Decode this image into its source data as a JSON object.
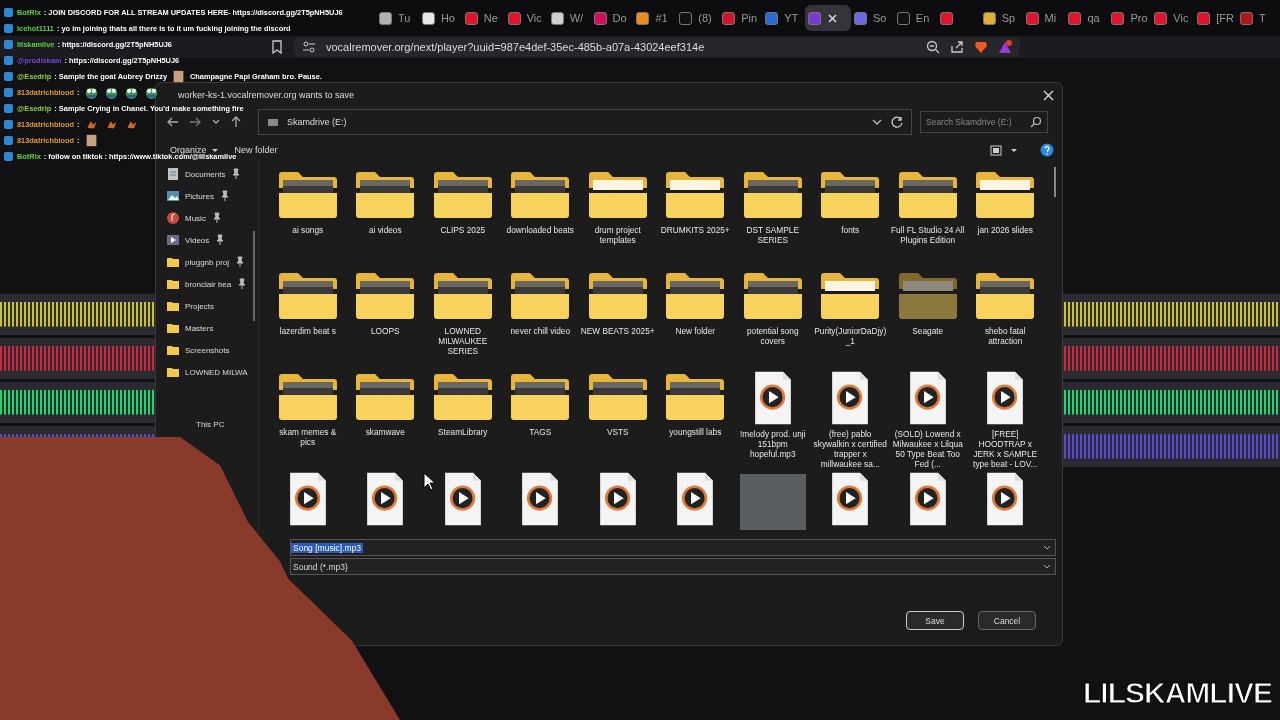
{
  "browser": {
    "tabs": [
      {
        "label": "Tu",
        "color": "#b0b0b0",
        "selected": false
      },
      {
        "label": "Ho",
        "color": "#e8e8e8",
        "selected": false
      },
      {
        "label": "Ne",
        "color": "#e0142a",
        "selected": false
      },
      {
        "label": "Vic",
        "color": "#e0142a",
        "selected": false
      },
      {
        "label": "W/",
        "color": "#cfcfcf",
        "selected": false
      },
      {
        "label": "Do",
        "color": "#d0105a",
        "selected": false
      },
      {
        "label": "#1",
        "color": "#f08a1c",
        "selected": false
      },
      {
        "label": "(8)",
        "color": "#111111",
        "selected": false
      },
      {
        "label": "Pin",
        "color": "#d0142a",
        "selected": false
      },
      {
        "label": "YT",
        "color": "#2a6ad8",
        "selected": false
      },
      {
        "color": "#7a3ad8",
        "selected": true
      },
      {
        "label": "So",
        "color": "#6a6ae8",
        "selected": false
      },
      {
        "label": "En",
        "color": "#111111",
        "selected": false
      },
      {
        "color": "#e0142a",
        "selected": false
      },
      {
        "label": "Sp",
        "color": "#e0b030",
        "selected": false
      },
      {
        "label": "Mi",
        "color": "#e0142a",
        "selected": false
      },
      {
        "label": "qa",
        "color": "#e0142a",
        "selected": false
      },
      {
        "label": "Pro",
        "color": "#e0142a",
        "selected": false
      },
      {
        "label": "Vic",
        "color": "#e0142a",
        "selected": false
      },
      {
        "label": "[FR",
        "color": "#e0142a",
        "selected": false
      },
      {
        "label": "T",
        "color": "#b01818",
        "selected": false
      }
    ],
    "url": "vocalremover.org/next/player?uuid=987e4def-35ec-485b-a07a-43024eef314e"
  },
  "chat": [
    {
      "user": "BotRix",
      "color": "#5ad43c",
      "text": ": JOIN DISCORD FOR ALL STREAM UPDATES HERE- https://discord.gg/2T5pNH5UJ6"
    },
    {
      "user": "icehot1111",
      "color": "#5ad43c",
      "text": ": yo im joining thats all there is to it um fucking joining the discord"
    },
    {
      "user": "lilskamlive",
      "color": "#5ad43c",
      "text": ": https://discord.gg/2T5pNH5UJ6"
    },
    {
      "user": "@prodiskam",
      "color": "#7a4ad8",
      "text": ": https://discord.gg/2T5pNH5UJ6"
    },
    {
      "user": "@Esedrip",
      "color": "#8fd43c",
      "text": ": Sample the goat Aubrey Drizzy",
      "emotes": [
        {
          "kind": "face"
        }
      ],
      "text_after": "Champagne Papi Graham bro. Pause."
    },
    {
      "user": "813datrichblood",
      "color": "#e09a2a",
      "text": ":",
      "emotes": [
        {
          "kind": "frog"
        },
        {
          "kind": "frog"
        },
        {
          "kind": "frog"
        },
        {
          "kind": "frog"
        }
      ]
    },
    {
      "user": "@Esedrip",
      "color": "#8fd43c",
      "text": ": Sample Crying in Chanel. You'd make something fire"
    },
    {
      "user": "813datrichblood",
      "color": "#e09a2a",
      "text": ":",
      "emotes": [
        {
          "kind": "bird"
        },
        {
          "kind": "bird"
        },
        {
          "kind": "bird"
        }
      ]
    },
    {
      "user": "813datrichblood",
      "color": "#e09a2a",
      "text": ":",
      "emotes": [
        {
          "kind": "face"
        }
      ]
    },
    {
      "user": "BotRix",
      "color": "#5ad43c",
      "text": ": follow on tiktok : https://www.tiktok.com/@lilskamlive"
    }
  ],
  "dialog": {
    "title": "worker-ks-1.vocalremover.org wants to save",
    "path": "Skamdrive (E:)",
    "search": {
      "placeholder": "Search Skamdrive (E:)"
    },
    "toolbar": [
      "Organize",
      "New folder"
    ],
    "sidebar": [
      {
        "label": "Documents",
        "kind": "documents",
        "pinned": true
      },
      {
        "label": "Pictures",
        "kind": "pictures",
        "pinned": true
      },
      {
        "label": "Music",
        "kind": "music",
        "pinned": true
      },
      {
        "label": "Videos",
        "kind": "videos",
        "pinned": true
      },
      {
        "label": "pluggnb proj",
        "kind": "folder",
        "pinned": true
      },
      {
        "label": "bronclair bea",
        "kind": "folder",
        "pinned": true
      },
      {
        "label": "Projects",
        "kind": "folder",
        "pinned": false
      },
      {
        "label": "Masters",
        "kind": "folder",
        "pinned": false
      },
      {
        "label": "Screenshots",
        "kind": "folder",
        "pinned": false
      },
      {
        "label": "LOWNED MILWA",
        "kind": "folder",
        "pinned": false
      },
      {
        "label": "This PC",
        "kind": "pc",
        "pinned": false
      }
    ],
    "items": [
      {
        "name": "ai songs",
        "kind": "folder",
        "thumbnail": true
      },
      {
        "name": "ai videos",
        "kind": "folder",
        "thumbnail": true
      },
      {
        "name": "CLIPS 2025",
        "kind": "folder",
        "thumbnail": true
      },
      {
        "name": "downloaded beats",
        "kind": "folder",
        "thumbnail": true
      },
      {
        "name": "drum project templates",
        "kind": "folder",
        "thumbnail": false
      },
      {
        "name": "DRUMKITS 2025+",
        "kind": "folder",
        "thumbnail": false
      },
      {
        "name": "DST SAMPLE SERIES",
        "kind": "folder",
        "thumbnail": true
      },
      {
        "name": "fonts",
        "kind": "folder",
        "thumbnail": true
      },
      {
        "name": "Full FL Studio 24 All Plugins Edition",
        "kind": "folder",
        "thumbnail": true
      },
      {
        "name": "jan 2026 slides",
        "kind": "folder",
        "thumbnail": false
      },
      {
        "name": "lazerdim beat s",
        "kind": "folder",
        "thumbnail": true
      },
      {
        "name": "LOOPS",
        "kind": "folder",
        "thumbnail": true
      },
      {
        "name": "LOWNED MILWAUKEE SERIES",
        "kind": "folder",
        "thumbnail": true
      },
      {
        "name": "never chill video",
        "kind": "folder",
        "thumbnail": true
      },
      {
        "name": "NEW BEATS 2025+",
        "kind": "folder",
        "thumbnail": true
      },
      {
        "name": "New folder",
        "kind": "folder",
        "thumbnail": true
      },
      {
        "name": "potential song covers",
        "kind": "folder",
        "thumbnail": true
      },
      {
        "name": "Purity(JuniorDaDjy)_1",
        "kind": "folder",
        "thumbnail": false
      },
      {
        "name": "Seagate",
        "kind": "folder",
        "thumbnail": false,
        "hidden": true
      },
      {
        "name": "shebo fatal attraction",
        "kind": "folder",
        "thumbnail": true
      },
      {
        "name": "skam memes & pics",
        "kind": "folder",
        "thumbnail": true
      },
      {
        "name": "skamwave",
        "kind": "folder",
        "thumbnail": true
      },
      {
        "name": "SteamLibrary",
        "kind": "folder",
        "thumbnail": true
      },
      {
        "name": "TAGS",
        "kind": "folder",
        "thumbnail": true
      },
      {
        "name": "VSTS",
        "kind": "folder",
        "thumbnail": true
      },
      {
        "name": "youngstill labs",
        "kind": "folder",
        "thumbnail": true
      },
      {
        "name": "!melody prod. unji 151bpm hopeful.mp3",
        "kind": "audio"
      },
      {
        "name": "(free) pablo skywalkin x certified trapper x millwaukee sa...",
        "kind": "audio"
      },
      {
        "name": "(SOLD) Lowend x Milwaukee x Lilqua 50 Type Beat Too Fed (...",
        "kind": "audio"
      },
      {
        "name": "[FREE] HOODTRAP x JERK x SAMPLE type beat - LOV...",
        "kind": "audio"
      },
      {
        "kind": "audio"
      },
      {
        "kind": "audio"
      },
      {
        "kind": "audio"
      },
      {
        "kind": "audio"
      },
      {
        "kind": "audio"
      },
      {
        "kind": "audio"
      },
      {
        "kind": "video"
      },
      {
        "kind": "audio"
      },
      {
        "kind": "audio"
      },
      {
        "kind": "audio"
      }
    ],
    "file_name": {
      "value": "Song [music].mp3",
      "selected": true
    },
    "file_type": "Sound (*.mp3)",
    "buttons": [
      "Save",
      "Cancel"
    ]
  },
  "overlay": {
    "streamer": "LILSKAMLIVE"
  }
}
